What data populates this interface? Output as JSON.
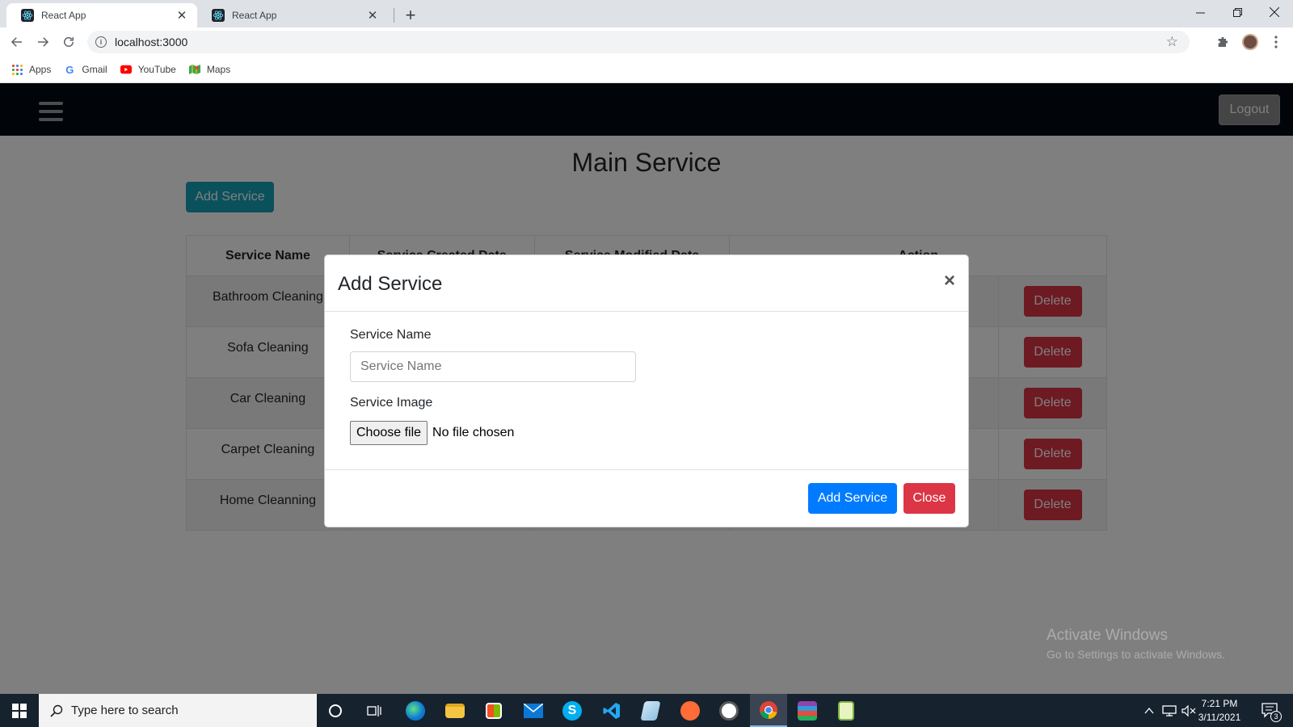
{
  "browser": {
    "tabs": [
      {
        "title": "React App",
        "active": true
      },
      {
        "title": "React App",
        "active": false
      }
    ],
    "new_tab": "+",
    "url": "localhost:3000",
    "bookmarks": [
      {
        "label": "Apps",
        "icon": "apps-grid-icon"
      },
      {
        "label": "Gmail",
        "icon": "google-icon"
      },
      {
        "label": "YouTube",
        "icon": "youtube-icon"
      },
      {
        "label": "Maps",
        "icon": "maps-icon"
      }
    ]
  },
  "app": {
    "nav": {
      "logout_label": "Logout"
    },
    "title": "Main Service",
    "add_button_label": "Add Service",
    "table": {
      "columns": [
        "Service Name",
        "Service Created Date",
        "Service Modified Date",
        "Action"
      ],
      "rows": [
        {
          "name": "Bathroom Cleaning",
          "action": "Delete"
        },
        {
          "name": "Sofa Cleaning",
          "action": "Delete"
        },
        {
          "name": "Car Cleaning",
          "action": "Delete"
        },
        {
          "name": "Carpet Cleaning",
          "action": "Delete"
        },
        {
          "name": "Home Cleanning",
          "action": "Delete"
        }
      ]
    }
  },
  "modal": {
    "title": "Add Service",
    "close_glyph": "×",
    "name_label": "Service Name",
    "name_placeholder": "Service Name",
    "image_label": "Service Image",
    "file_button": "Choose file",
    "file_status": "No file chosen",
    "submit_label": "Add Service",
    "close_label": "Close"
  },
  "watermark": {
    "line1": "Activate Windows",
    "line2": "Go to Settings to activate Windows."
  },
  "taskbar": {
    "search_placeholder": "Type here to search",
    "time": "7:21 PM",
    "date": "3/11/2021",
    "notification_count": "3"
  },
  "colors": {
    "primary": "#007bff",
    "danger": "#dc3545",
    "info": "#17a2b8",
    "navbar": "#020813"
  }
}
